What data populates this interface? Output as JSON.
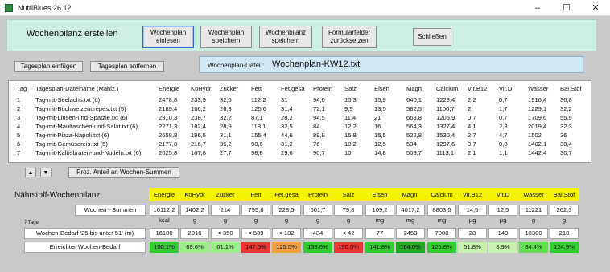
{
  "window": {
    "title": "NutriBlues 26.12",
    "min": "–",
    "max": "☐",
    "close": "✕"
  },
  "top": {
    "title": "Wochenbilanz erstellen",
    "buttons": [
      {
        "label": "Wochenplan\neinlesen"
      },
      {
        "label": "Wochenplan\nspeichern"
      },
      {
        "label": "Wochenbilanz\nspeichern"
      },
      {
        "label": "Formularfelder\nzurücksetzen"
      },
      {
        "label": "Schließen"
      }
    ]
  },
  "dayplan": {
    "insert": "Tagesplan einfügen",
    "remove": "Tagesplan entfernen"
  },
  "file": {
    "label": "Wochenplan-Datei :",
    "name": "Wochenplan-KW12.txt"
  },
  "table": {
    "headers": [
      "Tag",
      "Tagesplan-Dateiname (Mahlz.)",
      "Energie",
      "KoHydr",
      "Zucker",
      "Fett",
      "Fet.gesä",
      "Protein",
      "Salz",
      "Eisen",
      "Magn.",
      "Calcium",
      "Vit.B12",
      "Vit.D",
      "Wasser",
      "Bal.Stof"
    ],
    "rows": [
      [
        "1",
        "Tag-mit-Seelachs.txt (6)",
        "2478,8",
        "233,9",
        "32,6",
        "112,2",
        "31",
        "94,6",
        "10,3",
        "15,9",
        "640,1",
        "1228,4",
        "2,2",
        "0,7",
        "1916,4",
        "36,8"
      ],
      [
        "2",
        "Tag-mit-Buchweizencrepes.txt (5)",
        "2189,4",
        "166,2",
        "26,3",
        "125,6",
        "31,4",
        "72,1",
        "9,9",
        "13,5",
        "582,5",
        "1100,7",
        "2",
        "1,7",
        "1229,1",
        "32,2"
      ],
      [
        "3",
        "Tag-mit-Linsen-und-Spätzle.txt (6)",
        "2310,3",
        "238,7",
        "32,2",
        "87,1",
        "28,2",
        "94,5",
        "11,4",
        "21",
        "663,8",
        "1205,9",
        "0,7",
        "0,7",
        "1709,6",
        "55,9"
      ],
      [
        "4",
        "Tag-mit-Maultaschen-und-Salat.txt (6)",
        "2271,3",
        "182,4",
        "28,9",
        "118,1",
        "32,5",
        "84",
        "12,2",
        "16",
        "564,3",
        "1327,4",
        "4,1",
        "2,8",
        "2019,4",
        "32,3"
      ],
      [
        "5",
        "Tag-mit-Pizza-Napoli.txt (6)",
        "2658,8",
        "196,5",
        "31,1",
        "155,4",
        "44,6",
        "89,8",
        "15,8",
        "15,5",
        "522,8",
        "1530,4",
        "2,7",
        "4,7",
        "1502",
        "36"
      ],
      [
        "6",
        "Tag-mit-Gemüsereis.txt (5)",
        "2177,8",
        "216,7",
        "35,2",
        "98,6",
        "31,2",
        "76",
        "10,2",
        "12,5",
        "534",
        "1297,6",
        "0,7",
        "0,8",
        "1402,1",
        "38,4"
      ],
      [
        "7",
        "Tag-mit-Kalbsbraten-und-Nudeln.txt (6)",
        "2025,8",
        "167,8",
        "27,7",
        "98,8",
        "29,6",
        "90,7",
        "10",
        "14,8",
        "509,7",
        "1113,1",
        "2,1",
        "1,1",
        "1442,4",
        "30,7"
      ]
    ]
  },
  "controls": {
    "up": "▲",
    "down": "▼",
    "percent": "Proz. Anteil an Wochen-Summen"
  },
  "bilanz": {
    "title": "Nährstoff-Wochenbilanz",
    "headers": [
      "Energie",
      "KoHydr",
      "Zucker",
      "Fett",
      "Fet.gesä",
      "Protein",
      "Salz",
      "Eisen",
      "Magn.",
      "Calcium",
      "Vit.B12",
      "Vit.D",
      "Wasser",
      "Bal.Stof"
    ],
    "sum_label": "Wochen - Summen",
    "sums": [
      "16112,2",
      "1402,2",
      "214",
      "795,8",
      "228,5",
      "601,7",
      "79,8",
      "109,2",
      "4017,2",
      "8803,5",
      "14,5",
      "12,5",
      "11221",
      "262,3"
    ],
    "units": [
      "kcal",
      "g",
      "g",
      "g",
      "g",
      "g",
      "g",
      "mg",
      "mg",
      "mg",
      "µg",
      "µg",
      "g",
      "g"
    ],
    "days_note": "7 Tage",
    "need_label": "Wochen-Bedarf '25 bis unter 51' (m)",
    "needs": [
      "16100",
      "2016",
      "< 350",
      "< 539",
      "< 182",
      "434",
      "< 42",
      "77",
      "2450",
      "7000",
      "28",
      "140",
      "13300",
      "210"
    ],
    "reached_label": "Erreichter Wochen-Bedarf",
    "reached": [
      "100.1%",
      "69.6%",
      "61.1%",
      "147.6%",
      "125.5%",
      "138.6%",
      "190.0%",
      "141.8%",
      "164.0%",
      "125.8%",
      "51.8%",
      "8.9%",
      "84.4%",
      "124.9%"
    ],
    "reached_colors": [
      "#33cc33",
      "#99ee88",
      "#99ee88",
      "#ee3333",
      "#f2a040",
      "#33cc33",
      "#ee3333",
      "#33cc33",
      "#22aa22",
      "#33cc33",
      "#c8f0b0",
      "#c8f0b0",
      "#66dd55",
      "#33cc33"
    ]
  }
}
